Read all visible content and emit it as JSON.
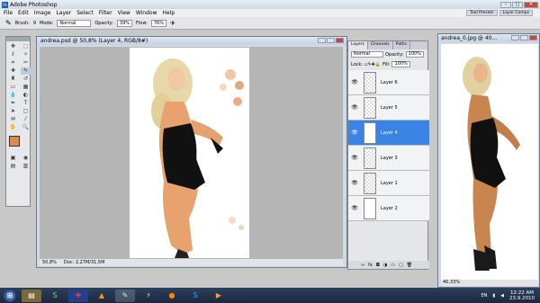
{
  "app": {
    "title": "Adobe Photoshop"
  },
  "menu": [
    "File",
    "Edit",
    "Image",
    "Layer",
    "Select",
    "Filter",
    "View",
    "Window",
    "Help"
  ],
  "workspace_tabs": [
    "Tool Presets",
    "Layer Comps"
  ],
  "options": {
    "brush_label": "Brush:",
    "brush_size": "9",
    "mode_label": "Mode:",
    "mode_value": "Normal",
    "opacity_label": "Opacity:",
    "opacity_value": "39%",
    "flow_label": "Flow:",
    "flow_value": "76%"
  },
  "document": {
    "title": "andrea.psd @ 50,8% (Layer 4, RGB/8#)",
    "zoom": "50,8%",
    "doc_size": "Doc: 2,27M/31,5M"
  },
  "layers_panel": {
    "tabs": [
      "Layers",
      "Channels",
      "Paths"
    ],
    "blend_mode": "Normal",
    "opacity_label": "Opacity:",
    "opacity_value": "100%",
    "lock_label": "Lock:",
    "fill_label": "Fill:",
    "fill_value": "100%",
    "layers": [
      {
        "name": "Layer 6",
        "selected": false
      },
      {
        "name": "Layer 5",
        "selected": false
      },
      {
        "name": "Layer 4",
        "selected": true
      },
      {
        "name": "Layer 3",
        "selected": false
      },
      {
        "name": "Layer 1",
        "selected": false
      },
      {
        "name": "Layer 2",
        "selected": false
      }
    ]
  },
  "second_document": {
    "title": "andrea_0.jpg @ 40...",
    "zoom": "40,33%"
  },
  "taskbar": {
    "language": "EN",
    "time": "12:22 AM",
    "date": "23.9.2010"
  }
}
